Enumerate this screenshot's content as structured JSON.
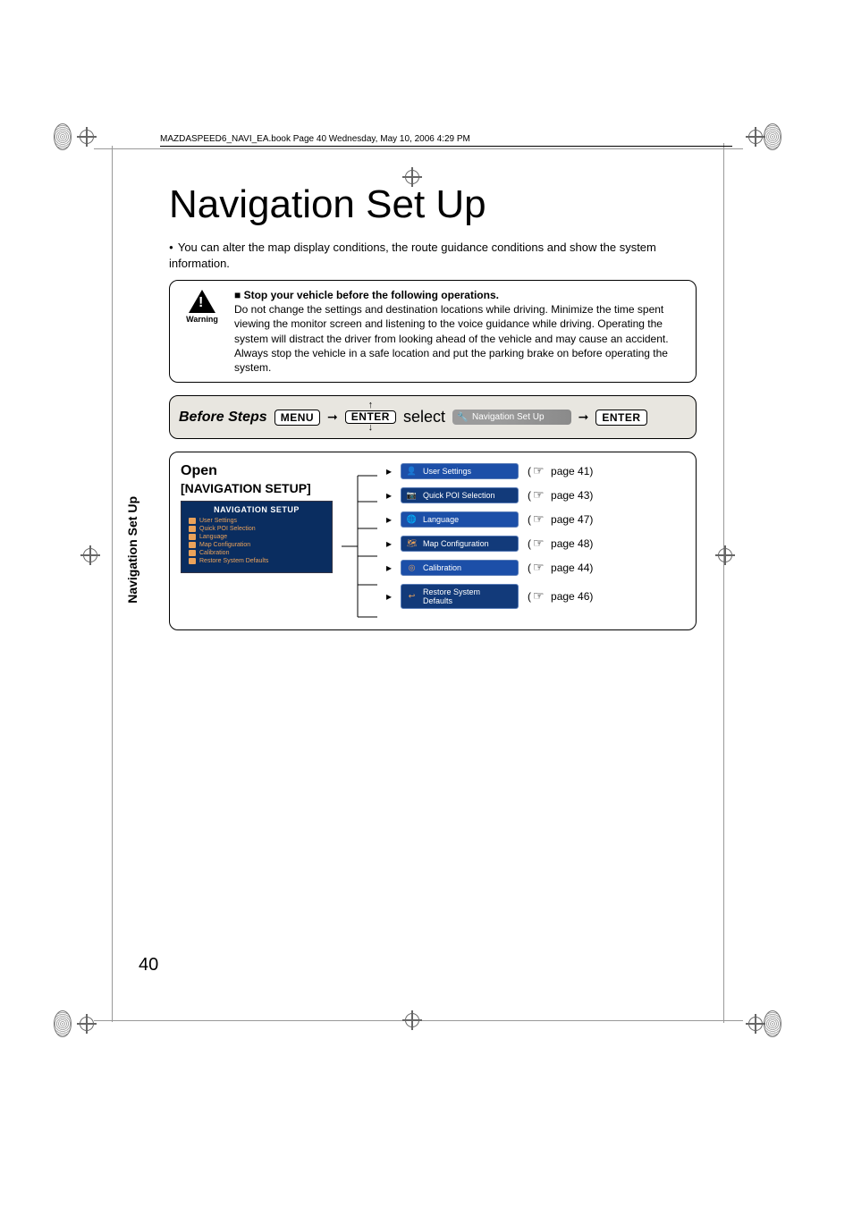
{
  "header": {
    "book_line": "MAZDASPEED6_NAVI_EA.book  Page 40  Wednesday, May 10, 2006  4:29 PM"
  },
  "title": "Navigation Set Up",
  "intro": "You can alter the map display conditions, the route guidance conditions and show the system information.",
  "warning": {
    "label": "Warning",
    "heading": "Stop your vehicle before the following operations.",
    "body1": "Do not change the settings and destination locations while driving. Minimize the time spent viewing the monitor screen and listening to the voice guidance while driving. Operating the system will distract the driver from looking ahead of the vehicle and may cause an accident.",
    "body2": "Always stop the vehicle in a safe location and put the parking brake on before operating the system."
  },
  "steps": {
    "label": "Before Steps",
    "menu_btn": "MENU",
    "enter_btn": "ENTER",
    "select": "select",
    "chip": "Navigation Set Up",
    "enter_btn2": "ENTER"
  },
  "setup": {
    "open": "Open",
    "open_sub": "[NAVIGATION SETUP]",
    "screen_head": "NAVIGATION SETUP",
    "screen_items": [
      "User Settings",
      "Quick POI Selection",
      "Language",
      "Map Configuration",
      "Calibration",
      "Restore System Defaults"
    ],
    "rows": [
      {
        "label": "User Settings",
        "page": "page 41",
        "hi": true
      },
      {
        "label": "Quick POI Selection",
        "page": "page 43",
        "hi": false
      },
      {
        "label": "Language",
        "page": "page 47",
        "hi": true
      },
      {
        "label": "Map Configuration",
        "page": "page 48",
        "hi": false
      },
      {
        "label": "Calibration",
        "page": "page 44",
        "hi": true
      },
      {
        "label": "Restore System Defaults",
        "page": "page 46",
        "hi": false
      }
    ]
  },
  "side_tab": "Navigation Set Up",
  "page_number": "40"
}
